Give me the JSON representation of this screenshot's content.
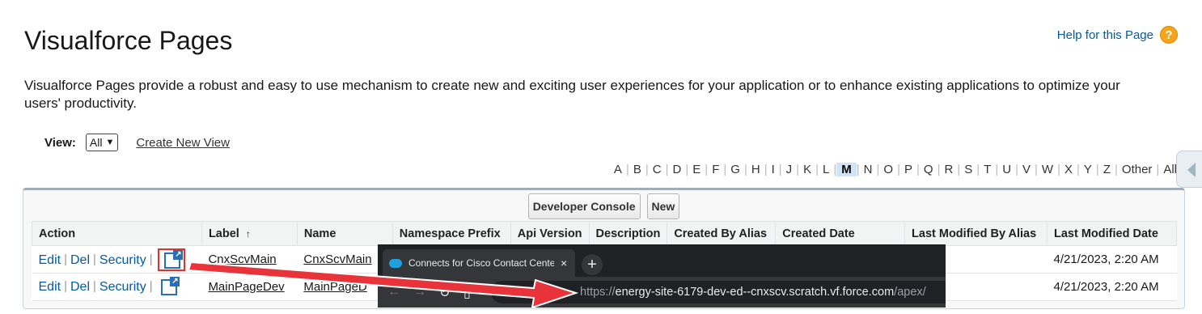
{
  "header": {
    "title": "Visualforce Pages",
    "help_label": "Help for this Page",
    "help_icon": "question-icon"
  },
  "description": "Visualforce Pages provide a robust and easy to use mechanism to create new and exciting user experiences for your application or to enhance existing applications to optimize your users' productivity.",
  "view": {
    "label": "View:",
    "selected": "All",
    "create_link": "Create New View"
  },
  "alphabet": [
    "A",
    "B",
    "C",
    "D",
    "E",
    "F",
    "G",
    "H",
    "I",
    "J",
    "K",
    "L",
    "M",
    "N",
    "O",
    "P",
    "Q",
    "R",
    "S",
    "T",
    "U",
    "V",
    "W",
    "X",
    "Y",
    "Z",
    "Other",
    "All"
  ],
  "alphabet_active": "M",
  "buttons": {
    "developer_console": "Developer Console",
    "new": "New"
  },
  "table": {
    "columns": [
      "Action",
      "Label",
      "Name",
      "Namespace Prefix",
      "Api Version",
      "Description",
      "Created By Alias",
      "Created Date",
      "Last Modified By Alias",
      "Last Modified Date"
    ],
    "sort_indicator": "↑",
    "action_links": {
      "edit": "Edit",
      "del": "Del",
      "security": "Security"
    },
    "rows": [
      {
        "label": "CnxScvMain",
        "name": "CnxScvMain",
        "last_modified_date": "4/21/2023, 2:20 AM"
      },
      {
        "label": "MainPageDev",
        "name": "MainPageD",
        "last_modified_date": "4/21/2023, 2:20 AM"
      }
    ]
  },
  "browser": {
    "tab_title": "Connects for Cisco Contact Cente",
    "tab_close": "×",
    "new_tab": "+",
    "url_prefix": "https://",
    "url_host": "energy-site-6179-dev-ed--cnxscv.scratch.vf.force.com",
    "url_path": "/apex/"
  },
  "colors": {
    "link": "#015ba7",
    "highlight_box": "#e0302f",
    "arrow": "#e8333a",
    "alpha_active_bg": "#cfe4f7"
  }
}
